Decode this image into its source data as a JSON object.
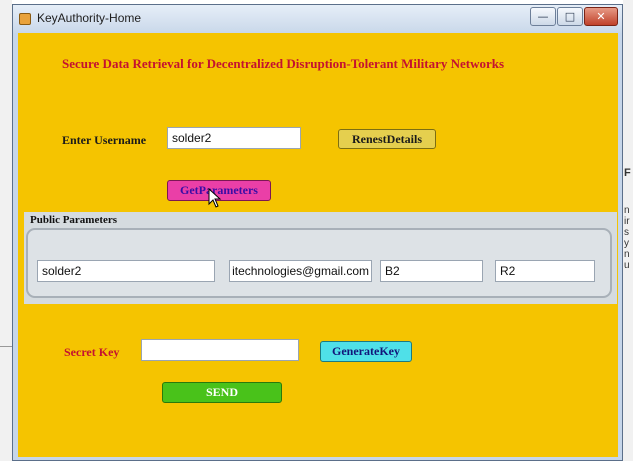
{
  "window": {
    "title": "KeyAuthority-Home",
    "buttons": {
      "minimize": "—",
      "maximize": "□",
      "close": "✕"
    }
  },
  "app": {
    "heading": "Secure Data Retrieval for Decentralized Disruption-Tolerant Military Networks",
    "username_label": "Enter Username",
    "username_value": "solder2",
    "request_button": "RenestDetails",
    "get_parameters_button": "GetParameters",
    "public_parameters": {
      "title": "Public Parameters",
      "fields": [
        "solder2",
        "itechnologies@gmail.com",
        "B2",
        "R2"
      ]
    },
    "secret_key_label": "Secret Key",
    "secret_key_value": "",
    "generate_key_button": "GenerateKey",
    "send_button": "SEND"
  },
  "background_page": {
    "letters_right": [
      "F",
      "n",
      "ir",
      "s",
      "y",
      "n",
      "u"
    ]
  },
  "colors": {
    "panel_bg": "#f5c400",
    "heading": "#c41230",
    "label_dark": "#1a1a1a",
    "label_red": "#c41230"
  }
}
